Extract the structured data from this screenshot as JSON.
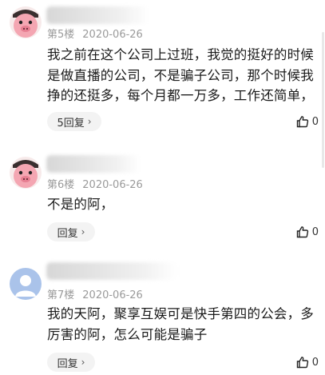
{
  "comments": [
    {
      "avatar": "pig-avatar",
      "floor": "第5楼",
      "date": "2020-06-26",
      "text": "我之前在这个公司上过班，我觉的挺好的时候是做直播的公司，不是骗子公司，那个时候我挣的还挺多，每个月都一万多，工作还简单，",
      "reply_label": "5回复",
      "likes": "0"
    },
    {
      "avatar": "pig-avatar",
      "floor": "第6楼",
      "date": "2020-06-26",
      "text": "不是的阿，",
      "reply_label": "回复",
      "likes": "0"
    },
    {
      "avatar": "default-user-avatar",
      "floor": "第7楼",
      "date": "2020-06-26",
      "text": "我的天阿，聚享互娱可是快手第四的公会，多厉害的阿，怎么可能是骗子",
      "reply_label": "回复",
      "likes": "0"
    }
  ]
}
